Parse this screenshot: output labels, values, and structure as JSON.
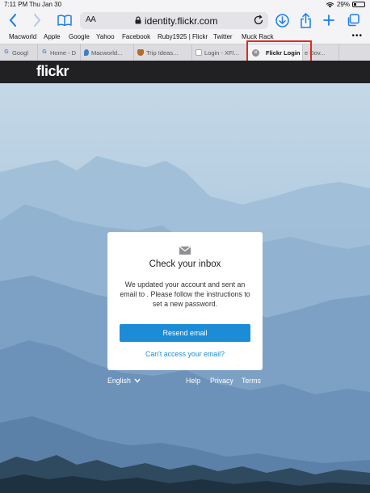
{
  "status": {
    "time": "7:11 PM",
    "date": "Thu Jan 30",
    "battery": "29%",
    "battery_level": 0.29
  },
  "address_bar": {
    "text_size_label": "AA",
    "url": "identity.flickr.com"
  },
  "favorites": [
    "Macworld",
    "Apple",
    "Google",
    "Yahoo",
    "Facebook",
    "Ruby1925 | Flickr",
    "Twitter",
    "Muck Rack"
  ],
  "tabs": [
    {
      "label": "Googl",
      "icon": "google-favicon"
    },
    {
      "label": "Home - D",
      "icon": "google-favicon"
    },
    {
      "label": "Macworld...",
      "icon": "macworld-favicon"
    },
    {
      "label": "Trip Ideas...",
      "icon": "trip-favicon"
    },
    {
      "label": "Login - XFI...",
      "icon": "generic-favicon"
    },
    {
      "label": "Flickr Login",
      "icon": "close-icon",
      "active": true
    },
    {
      "label": "e Dov...",
      "icon": ""
    }
  ],
  "flickr": {
    "logo": "flickr"
  },
  "card": {
    "title": "Check your inbox",
    "message": "We updated your account and sent an email to . Please follow the instructions to set a new password.",
    "button": "Resend email",
    "link": "Can't access your email?"
  },
  "footer": {
    "language": "English",
    "help": "Help",
    "privacy": "Privacy",
    "terms": "Terms"
  },
  "colors": {
    "accent": "#1d8cd6",
    "header": "#212124",
    "ios_blue": "#1a7cf0",
    "highlight": "#e02a1e"
  }
}
